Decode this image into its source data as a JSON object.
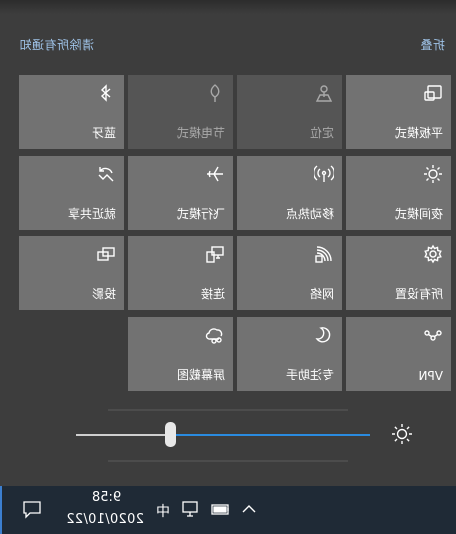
{
  "header": {
    "clear_all": "清除所有通知",
    "collapse": "折叠"
  },
  "tiles": {
    "tablet_mode": "平板模式",
    "location": "定位",
    "battery_saver": "节电模式",
    "bluetooth": "蓝牙",
    "night_light": "夜间模式",
    "mobile_hotspot": "移动热点",
    "airplane_mode": "飞行模式",
    "nearby_sharing": "就近共享",
    "all_settings": "所有设置",
    "network": "网络",
    "connect": "连接",
    "project": "投影",
    "vpn": "VPN",
    "focus_assist": "专注助手",
    "screen_snip": "屏幕截图"
  },
  "brightness": {
    "level_percent": 68
  },
  "taskbar": {
    "time": "9:58",
    "date": "2020/10/22",
    "ime": "中"
  },
  "colors": {
    "accent": "#2a8be0",
    "tile": "#727272",
    "tile_disabled": "#555555"
  },
  "icons": [
    "tablet-mode-icon",
    "location-icon",
    "battery-saver-icon",
    "bluetooth-icon",
    "night-light-icon",
    "hotspot-icon",
    "airplane-icon",
    "nearby-share-icon",
    "gear-icon",
    "network-icon",
    "connect-icon",
    "project-icon",
    "vpn-icon",
    "moon-icon",
    "screen-snip-icon",
    "sun-icon",
    "notification-icon",
    "battery-icon",
    "monitor-icon",
    "chevron-up-icon"
  ]
}
